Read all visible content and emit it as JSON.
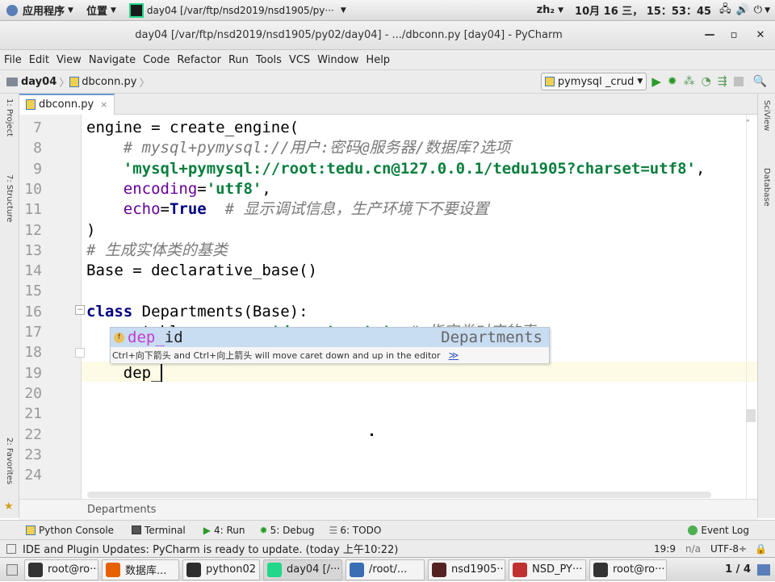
{
  "topbar": {
    "apps_label": "应用程序",
    "places_label": "位置",
    "window_title": "day04 [/var/ftp/nsd2019/nsd1905/py···",
    "input_method": "zh₂",
    "clock": "10月 16 三， 15：53：45"
  },
  "window": {
    "title": "day04 [/var/ftp/nsd2019/nsd1905/py02/day04] - .../dbconn.py [day04] - PyCharm"
  },
  "menu": [
    "File",
    "Edit",
    "View",
    "Navigate",
    "Code",
    "Refactor",
    "Run",
    "Tools",
    "VCS",
    "Window",
    "Help"
  ],
  "nav": {
    "project": "day04",
    "file": "dbconn.py",
    "run_config": "pymysql _crud"
  },
  "left_tools": {
    "project": "1: Project",
    "structure": "7: Structure",
    "favorites": "2: Favorites"
  },
  "right_tools": {
    "scview": "SciView",
    "database": "Database"
  },
  "tab": {
    "label": "dbconn.py"
  },
  "code": [
    {
      "n": "7",
      "t": "engine = create_engine("
    },
    {
      "n": "8",
      "t": "    # mysql+pymysql://用户:密码@服务器/数据库?选项"
    },
    {
      "n": "9",
      "t": "    'mysql+pymysql://root:tedu.cn@127.0.0.1/tedu1905?charset=utf8',"
    },
    {
      "n": "10",
      "t": "    encoding='utf8',"
    },
    {
      "n": "11",
      "t": "    echo=True  # 显示调试信息，生产环境下不要设置"
    },
    {
      "n": "12",
      "t": ")"
    },
    {
      "n": "13",
      "t": "# 生成实体类的基类"
    },
    {
      "n": "14",
      "t": "Base = declarative_base()"
    },
    {
      "n": "15",
      "t": ""
    },
    {
      "n": "16",
      "t": "class Departments(Base):"
    },
    {
      "n": "17",
      "t": "    __tablename__ = 'departments'  # 指定类对应的表"
    },
    {
      "n": "18",
      "t": ""
    },
    {
      "n": "19",
      "t": "    dep_"
    },
    {
      "n": "20",
      "t": ""
    },
    {
      "n": "21",
      "t": ""
    },
    {
      "n": "22",
      "t": ""
    },
    {
      "n": "23",
      "t": ""
    },
    {
      "n": "24",
      "t": ""
    }
  ],
  "autocomplete": {
    "badge": "f",
    "match": "dep_",
    "rest": "id",
    "type": "Departments",
    "hint": "Ctrl+向下箭头 and Ctrl+向上箭头 will move caret down and up in the editor",
    "hint_link": "≫"
  },
  "breadcrumb": "Departments",
  "toolwindows": [
    {
      "name": "python-console",
      "label": "Python Console"
    },
    {
      "name": "terminal",
      "label": "Terminal"
    },
    {
      "name": "run",
      "label": "4: Run"
    },
    {
      "name": "debug",
      "label": "5: Debug"
    },
    {
      "name": "todo",
      "label": "6: TODO"
    }
  ],
  "event_log": "Event Log",
  "status": {
    "message": "IDE and Plugin Updates: PyCharm is ready to update. (today 上午10:22)",
    "position": "19:9",
    "na": "n/a",
    "encoding": "UTF-8÷"
  },
  "taskbar": [
    {
      "name": "terminal",
      "label": "root@ro···",
      "color": "#333"
    },
    {
      "name": "firefox",
      "label": "数据库...",
      "color": "#e66000"
    },
    {
      "name": "python02",
      "label": "python02",
      "color": "#2e2e2e"
    },
    {
      "name": "pycharm",
      "label": "day04 [/···",
      "color": "#21d789"
    },
    {
      "name": "files",
      "label": "/root/...",
      "color": "#3b6db3"
    },
    {
      "name": "nsd",
      "label": "nsd1905···",
      "color": "#552222"
    },
    {
      "name": "nsdpy",
      "label": "NSD_PY···",
      "color": "#c03030"
    },
    {
      "name": "terminal2",
      "label": "root@ro···",
      "color": "#333"
    }
  ],
  "workspace": "1 / 4"
}
